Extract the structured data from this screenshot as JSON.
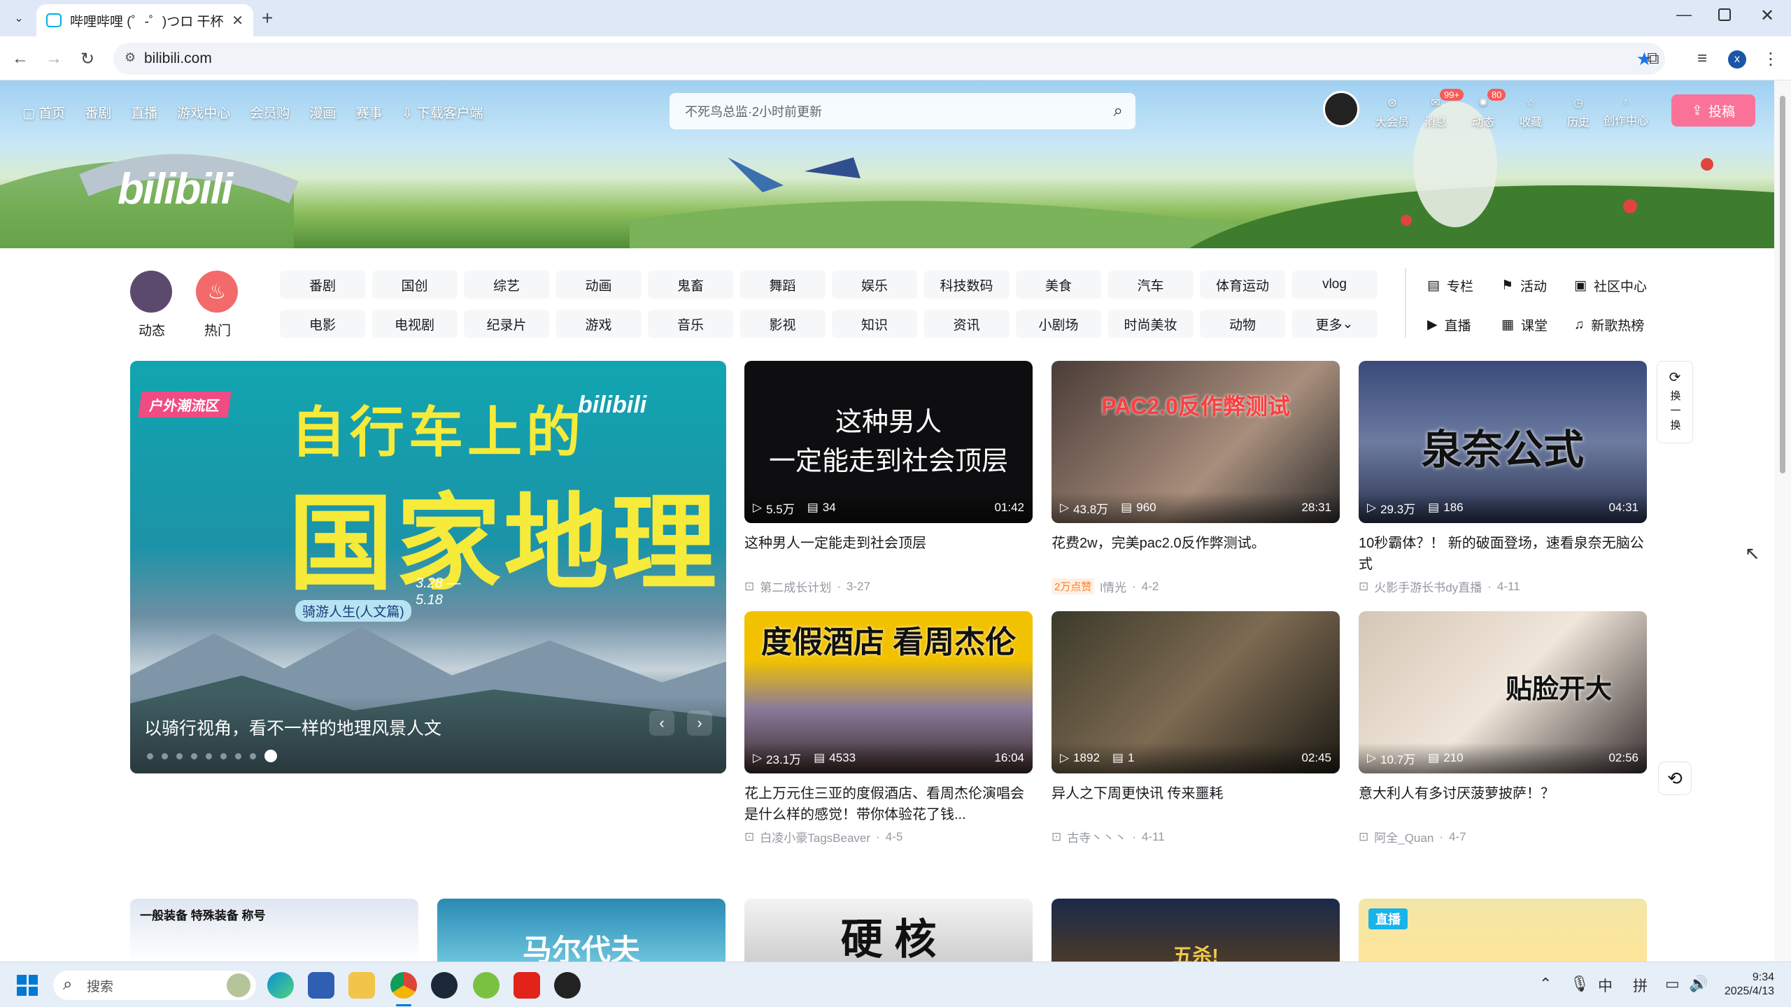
{
  "browser": {
    "tab_title": "哔哩哔哩 (゜-゜)つロ 干杯~-bilibili",
    "url": "bilibili.com",
    "profile_initial": "x"
  },
  "header": {
    "nav_left": [
      "首页",
      "番剧",
      "直播",
      "游戏中心",
      "会员购",
      "漫画",
      "赛事",
      "下载客户端"
    ],
    "search_placeholder": "不死鸟总监·2小时前更新",
    "nav_right": [
      {
        "label": "大会员",
        "icon": "vip-icon",
        "badge": ""
      },
      {
        "label": "消息",
        "icon": "message-icon",
        "badge": "99+"
      },
      {
        "label": "动态",
        "icon": "dynamic-icon",
        "badge": "80"
      },
      {
        "label": "收藏",
        "icon": "star-icon",
        "badge": ""
      },
      {
        "label": "历史",
        "icon": "history-icon",
        "badge": ""
      },
      {
        "label": "创作中心",
        "icon": "bulb-icon",
        "badge": ""
      }
    ],
    "upload_label": "投稿",
    "logo_text": "bilibili"
  },
  "quick": {
    "dynamic": "动态",
    "hot": "热门"
  },
  "channels": [
    [
      "番剧",
      "国创",
      "综艺",
      "动画",
      "鬼畜",
      "舞蹈",
      "娱乐",
      "科技数码",
      "美食",
      "汽车",
      "体育运动",
      "vlog"
    ],
    [
      "电影",
      "电视剧",
      "纪录片",
      "游戏",
      "音乐",
      "影视",
      "知识",
      "资讯",
      "小剧场",
      "时尚美妆",
      "动物",
      "更多"
    ]
  ],
  "side_links": [
    [
      "专栏",
      "活动",
      "社区中心"
    ],
    [
      "直播",
      "课堂",
      "新歌热榜"
    ]
  ],
  "carousel": {
    "title": "以骑行视角，看不一样的地理风景人文",
    "art_tag": "户外潮流区",
    "art_headline_1": "自行车上的",
    "art_headline_2": "国家地理",
    "art_dates": "3.28 — 5.18",
    "art_sub": "骑游人生(人文篇)",
    "art_logo": "bilibili",
    "dots": 9,
    "active_dot": 8
  },
  "refresh": {
    "label": "换一换"
  },
  "videos": [
    {
      "title": "这种男人一定能走到社会顶层",
      "views": "5.5万",
      "danmaku": "34",
      "duration": "01:42",
      "up": "第二成长计划",
      "date": "3-27",
      "tag": "",
      "thumb_text": "这种男人\n一定能走到社会顶层"
    },
    {
      "title": "花费2w，完美pac2.0反作弊测试。",
      "views": "43.8万",
      "danmaku": "960",
      "duration": "28:31",
      "up": "l情光",
      "date": "4-2",
      "tag": "2万点赞",
      "thumb_text": "PAC2.0反作弊测试"
    },
    {
      "title": "10秒霸体？！ 新的破面登场，速看泉奈无脑公式",
      "views": "29.3万",
      "danmaku": "186",
      "duration": "04:31",
      "up": "火影手游长书dy直播",
      "date": "4-11",
      "tag": "",
      "thumb_text": "泉奈公式"
    },
    {
      "title": "花上万元住三亚的度假酒店、看周杰伦演唱会是什么样的感觉！带你体验花了钱...",
      "views": "23.1万",
      "danmaku": "4533",
      "duration": "16:04",
      "up": "白凌小豪TagsBeaver",
      "date": "4-5",
      "tag": "",
      "thumb_text": "度假酒店 看周杰伦"
    },
    {
      "title": "异人之下周更快讯 传来噩耗",
      "views": "1892",
      "danmaku": "1",
      "duration": "02:45",
      "up": "古寺丶丶丶",
      "date": "4-11",
      "tag": "",
      "thumb_text": ""
    },
    {
      "title": "意大利人有多讨厌菠萝披萨！？",
      "views": "10.7万",
      "danmaku": "210",
      "duration": "02:56",
      "up": "阿全_Quan",
      "date": "4-7",
      "tag": "",
      "thumb_text": "贴脸开大"
    }
  ],
  "row3": [
    {
      "thumb_text": "一般装备  特殊装备  称号"
    },
    {
      "thumb_text": "马尔代夫"
    },
    {
      "thumb_text": "硬 核"
    },
    {
      "thumb_text": "五杀!"
    },
    {
      "thumb_text": "直播"
    }
  ],
  "taskbar": {
    "search_label": "搜索",
    "ime_1": "中",
    "ime_2": "拼",
    "time": "9:34",
    "date": "2025/4/13"
  },
  "colors": {
    "brand_pink": "#fb7299",
    "accent_blue": "#00aeec"
  }
}
